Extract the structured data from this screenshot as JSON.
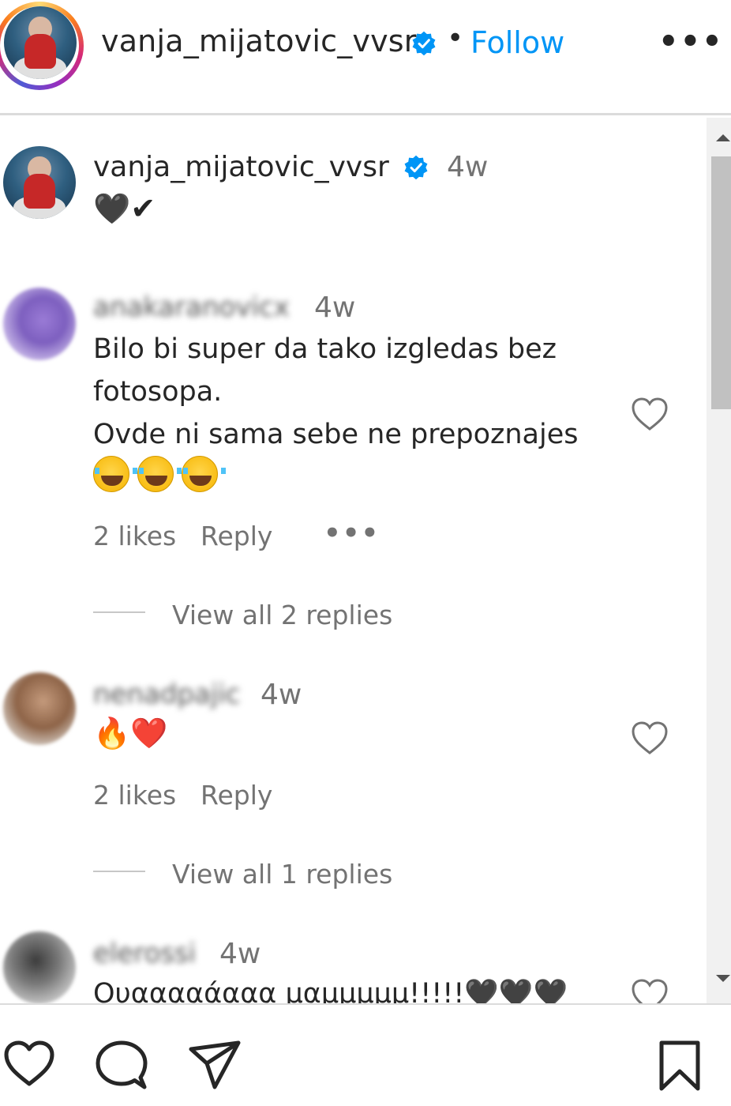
{
  "header": {
    "username": "vanja_mijatovic_vvsr",
    "separator": "•",
    "follow_label": "Follow",
    "more_label": "•••",
    "verified_icon": "verified-badge-icon",
    "accent_color": "#0095f6"
  },
  "caption": {
    "username": "vanja_mijatovic_vvsr",
    "time": "4w",
    "text": "🖤✔"
  },
  "comments": [
    {
      "username": "anakaranovicx",
      "time": "4w",
      "text": "Bilo bi super da tako izgledas bez\nfotosopa.\nOvde ni sama sebe ne prepoznajes",
      "emoji": "😂😂😂",
      "likes": "2 likes",
      "reply_label": "Reply",
      "more_label": "•••",
      "view_replies": "View all 2 replies"
    },
    {
      "username": "nenadpajic",
      "time": "4w",
      "text": "🔥❤️",
      "likes": "2 likes",
      "reply_label": "Reply",
      "view_replies": "View all 1 replies"
    },
    {
      "username": "elerossi",
      "time": "4w",
      "text": "Ουααααάααα μαμμμμμ!!!!!🖤🖤🖤"
    }
  ],
  "bottom_bar": {
    "icons": [
      "heart-icon",
      "comment-icon",
      "share-icon",
      "bookmark-icon"
    ]
  }
}
